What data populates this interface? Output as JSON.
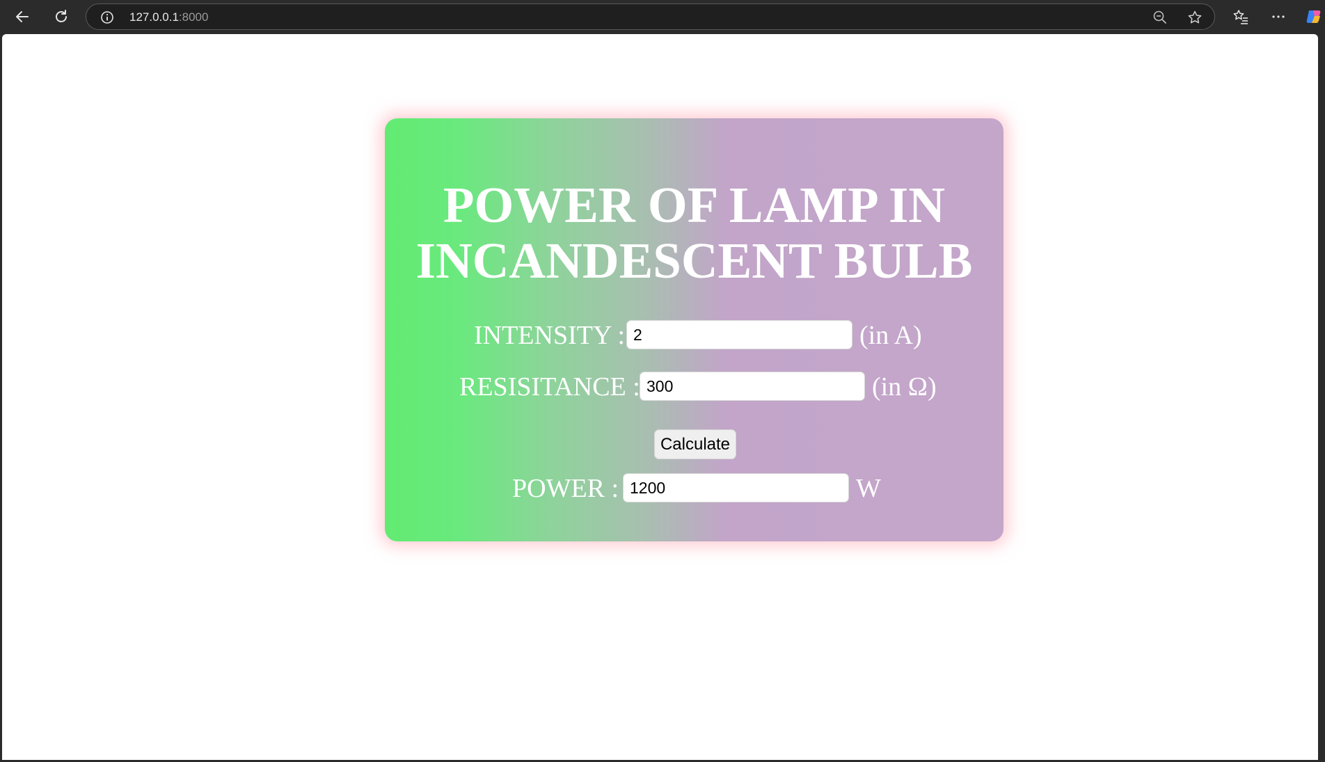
{
  "browser": {
    "url_host": "127.0.0.1",
    "url_port": ":8000",
    "icons": [
      "back-arrow-icon",
      "reload-icon",
      "site-info-icon",
      "zoom-out-icon",
      "favorite-star-icon",
      "favorites-list-icon",
      "more-menu-icon",
      "copilot-icon"
    ]
  },
  "page": {
    "title_line1": "POWER OF LAMP IN",
    "title_line2": "INCANDESCENT BULB",
    "intensity_label": "INTENSITY :",
    "intensity_value": "2",
    "intensity_unit": "(in A)",
    "resistance_label": "RESISITANCE :",
    "resistance_value": "300",
    "resistance_unit": "(in Ω)",
    "calculate_label": "Calculate",
    "power_label": "POWER :",
    "power_value": "1200",
    "power_unit": "W"
  },
  "colors": {
    "card_gradient_start": "#62eb72",
    "card_gradient_end": "#c4a6cb",
    "card_glow": "#ffacb6",
    "text": "#ffffff",
    "browser_chrome": "#2b2b2b"
  }
}
